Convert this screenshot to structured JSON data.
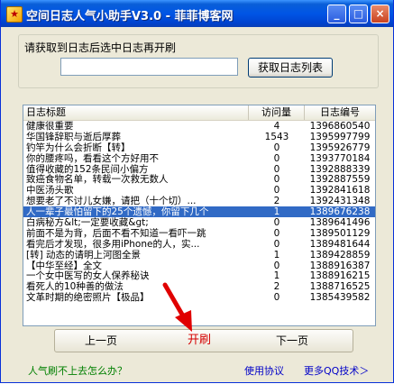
{
  "window": {
    "title": "空间日志人气小助手V3.0 - 菲菲博客网",
    "controls": [
      "_",
      "□",
      "×"
    ]
  },
  "top": {
    "group_label": "请获取到日志后选中日志再开刷",
    "url_value": "",
    "fetch_button": "获取日志列表"
  },
  "list": {
    "headers": [
      "日志标题",
      "访问量",
      "日志编号"
    ],
    "rows": [
      [
        "健康很重要",
        "4",
        "1396860540"
      ],
      [
        "华国锋辞职与逝后厚葬",
        "1543",
        "1395997799"
      ],
      [
        "钓竿为什么会折断【转】",
        "0",
        "1395926779"
      ],
      [
        "你的腰疼吗，看看这个方好用不",
        "0",
        "1393770184"
      ],
      [
        "值得收藏的152条民间小偏方",
        "0",
        "1392888339"
      ],
      [
        "致癌食物名单，转载一次救无数人",
        "0",
        "1392887559"
      ],
      [
        "中医汤头歌",
        "0",
        "1392841618"
      ],
      [
        "想要老了不讨儿女嫌，请把（十个切）...",
        "2",
        "1392431348"
      ],
      [
        "人一辈子最怕留下的25个遗憾，你留下几个",
        "1",
        "1389676238"
      ],
      [
        "白病秘方&lt;一定要收藏&gt;",
        "0",
        "1389641496"
      ],
      [
        "前面不是为背，后面不看不知道一看吓一跳",
        "0",
        "1389501129"
      ],
      [
        "看完后才发现，很多用iPhone的人，实...",
        "0",
        "1389481644"
      ],
      [
        "[转]  动态的请明上河图全景",
        "1",
        "1389428859"
      ],
      [
        "【中华至经】全文",
        "0",
        "1388916387"
      ],
      [
        "一个女中医写的女人保养秘诀",
        "1",
        "1388916215"
      ],
      [
        "看死人的10种善的做法",
        "2",
        "1388716525"
      ],
      [
        "文革时期的绝密照片【极品】",
        "0",
        "1385439582"
      ]
    ],
    "selected_row": 8
  },
  "pager": {
    "prev": "上一页",
    "refresh": "开刷",
    "next": "下一页"
  },
  "footer": {
    "help_link": "人气刷不上去怎么办？",
    "terms_link": "使用协议",
    "more_link": "更多QQ技术＞"
  },
  "colors": {
    "title_bar": "#0055e5",
    "selection": "#316ac5",
    "refresh_text": "#d40000",
    "arrow": "#e00000",
    "help_link": "#008000",
    "link": "#0000c8"
  }
}
